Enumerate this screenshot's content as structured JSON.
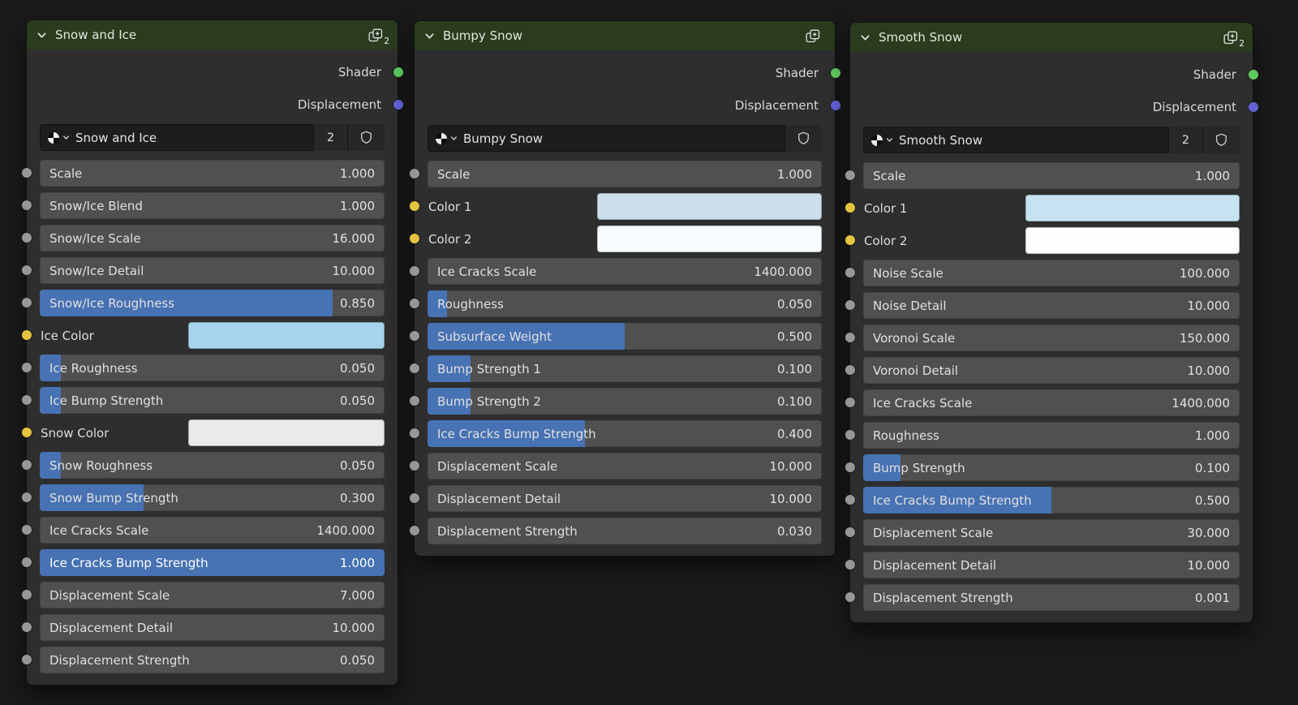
{
  "palette": {
    "accent": "#4772b3",
    "header_green": "#2a3b1e",
    "socket_value": "#979797",
    "socket_color": "#e2c440",
    "socket_shader": "#5dc85d",
    "socket_displacement": "#6161d6"
  },
  "nodes": [
    {
      "title": "Snow and Ice",
      "header_badge": "2",
      "outputs": [
        {
          "label": "Shader",
          "type": "shader"
        },
        {
          "label": "Displacement",
          "type": "displacement"
        }
      ],
      "group_selector": {
        "value": "Snow and Ice",
        "users": "2"
      },
      "inputs": [
        {
          "label": "Scale",
          "value": "1.000",
          "fill": 0,
          "socket": "value"
        },
        {
          "label": "Snow/Ice Blend",
          "value": "1.000",
          "fill": 0,
          "socket": "value"
        },
        {
          "label": "Snow/Ice Scale",
          "value": "16.000",
          "fill": 0,
          "socket": "value"
        },
        {
          "label": "Snow/Ice Detail",
          "value": "10.000",
          "fill": 0,
          "socket": "value"
        },
        {
          "label": "Snow/Ice Roughness",
          "value": "0.850",
          "fill": 85,
          "socket": "value"
        },
        {
          "label": "Ice Color",
          "swatch": "#a6d4ec",
          "socket": "color"
        },
        {
          "label": "Ice Roughness",
          "value": "0.050",
          "fill": 6,
          "socket": "value"
        },
        {
          "label": "Ice Bump Strength",
          "value": "0.050",
          "fill": 6,
          "socket": "value"
        },
        {
          "label": "Snow Color",
          "swatch": "#e9eaea",
          "socket": "color"
        },
        {
          "label": "Snow Roughness",
          "value": "0.050",
          "fill": 6,
          "socket": "value"
        },
        {
          "label": "Snow Bump Strength",
          "value": "0.300",
          "fill": 30,
          "socket": "value"
        },
        {
          "label": "Ice Cracks Scale",
          "value": "1400.000",
          "fill": 0,
          "socket": "value"
        },
        {
          "label": "Ice Cracks Bump Strength",
          "value": "1.000",
          "fill": 100,
          "socket": "value"
        },
        {
          "label": "Displacement Scale",
          "value": "7.000",
          "fill": 0,
          "socket": "value"
        },
        {
          "label": "Displacement Detail",
          "value": "10.000",
          "fill": 0,
          "socket": "value"
        },
        {
          "label": "Displacement Strength",
          "value": "0.050",
          "fill": 0,
          "socket": "value"
        }
      ]
    },
    {
      "title": "Bumpy Snow",
      "header_badge": "",
      "outputs": [
        {
          "label": "Shader",
          "type": "shader"
        },
        {
          "label": "Displacement",
          "type": "displacement"
        }
      ],
      "group_selector": {
        "value": "Bumpy Snow",
        "users": ""
      },
      "inputs": [
        {
          "label": "Scale",
          "value": "1.000",
          "fill": 0,
          "socket": "value"
        },
        {
          "label": "Color 1",
          "swatch": "#ccdeea",
          "socket": "color"
        },
        {
          "label": "Color 2",
          "swatch": "#f7fcff",
          "socket": "color"
        },
        {
          "label": "Ice Cracks Scale",
          "value": "1400.000",
          "fill": 0,
          "socket": "value"
        },
        {
          "label": "Roughness",
          "value": "0.050",
          "fill": 5,
          "socket": "value"
        },
        {
          "label": "Subsurface Weight",
          "value": "0.500",
          "fill": 50,
          "socket": "value"
        },
        {
          "label": "Bump Strength 1",
          "value": "0.100",
          "fill": 11,
          "socket": "value"
        },
        {
          "label": "Bump Strength 2",
          "value": "0.100",
          "fill": 11,
          "socket": "value"
        },
        {
          "label": "Ice Cracks Bump Strength",
          "value": "0.400",
          "fill": 40,
          "socket": "value"
        },
        {
          "label": "Displacement Scale",
          "value": "10.000",
          "fill": 0,
          "socket": "value"
        },
        {
          "label": "Displacement Detail",
          "value": "10.000",
          "fill": 0,
          "socket": "value"
        },
        {
          "label": "Displacement Strength",
          "value": "0.030",
          "fill": 0,
          "socket": "value"
        }
      ]
    },
    {
      "title": "Smooth Snow",
      "header_badge": "2",
      "outputs": [
        {
          "label": "Shader",
          "type": "shader"
        },
        {
          "label": "Displacement",
          "type": "displacement"
        }
      ],
      "group_selector": {
        "value": "Smooth Snow",
        "users": "2"
      },
      "inputs": [
        {
          "label": "Scale",
          "value": "1.000",
          "fill": 0,
          "socket": "value"
        },
        {
          "label": "Color 1",
          "swatch": "#c5e3f1",
          "socket": "color"
        },
        {
          "label": "Color 2",
          "swatch": "#fdfeff",
          "socket": "color"
        },
        {
          "label": "Noise Scale",
          "value": "100.000",
          "fill": 0,
          "socket": "value"
        },
        {
          "label": "Noise Detail",
          "value": "10.000",
          "fill": 0,
          "socket": "value"
        },
        {
          "label": "Voronoi Scale",
          "value": "150.000",
          "fill": 0,
          "socket": "value"
        },
        {
          "label": "Voronoi Detail",
          "value": "10.000",
          "fill": 0,
          "socket": "value"
        },
        {
          "label": "Ice Cracks Scale",
          "value": "1400.000",
          "fill": 0,
          "socket": "value"
        },
        {
          "label": "Roughness",
          "value": "1.000",
          "fill": 0,
          "socket": "value"
        },
        {
          "label": "Bump Strength",
          "value": "0.100",
          "fill": 10,
          "socket": "value"
        },
        {
          "label": "Ice Cracks Bump Strength",
          "value": "0.500",
          "fill": 50,
          "socket": "value"
        },
        {
          "label": "Displacement Scale",
          "value": "30.000",
          "fill": 0,
          "socket": "value"
        },
        {
          "label": "Displacement Detail",
          "value": "10.000",
          "fill": 0,
          "socket": "value"
        },
        {
          "label": "Displacement Strength",
          "value": "0.001",
          "fill": 0,
          "socket": "value"
        }
      ]
    }
  ]
}
